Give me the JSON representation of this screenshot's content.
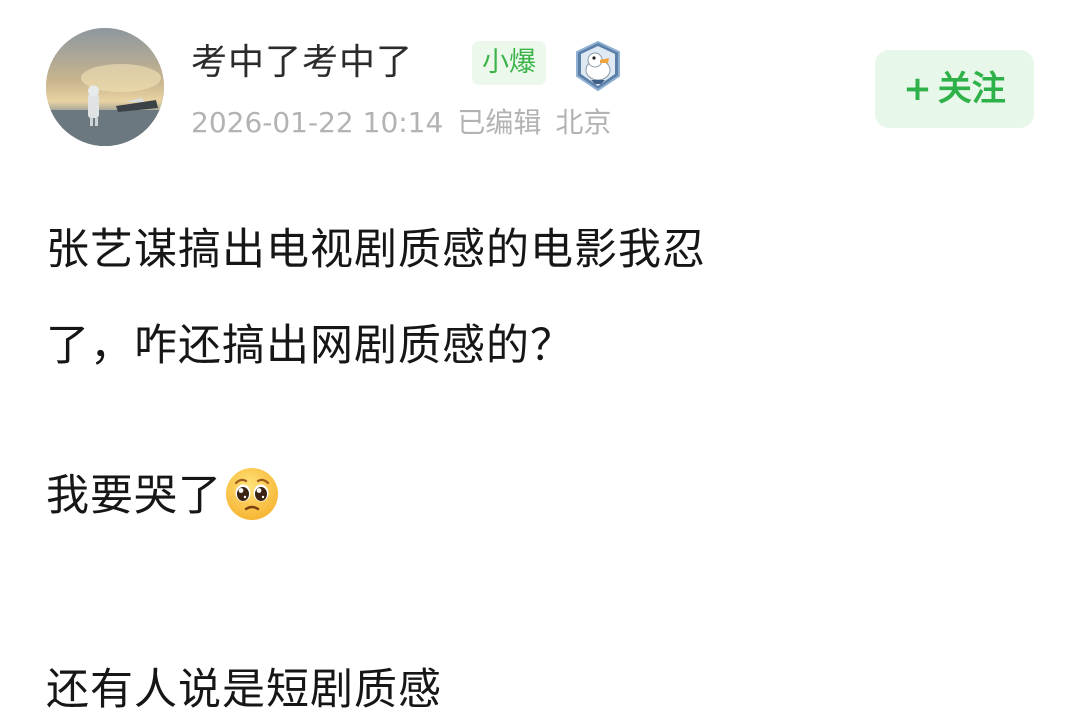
{
  "post": {
    "author": {
      "name": "考中了考中了",
      "tag": "小爆",
      "avatar_icon": "avatar-image",
      "badge_icon": "duck-badge-icon"
    },
    "meta": {
      "date": "2026-01-22 10:14",
      "edited": "已编辑",
      "location": "北京"
    },
    "follow": {
      "plus": "+",
      "label": "关注"
    },
    "text": {
      "line1": "张艺谋搞出电视剧质感的电影我忍",
      "line2": "了，咋还搞出网剧质感的？",
      "line3": "我要哭了",
      "line3_emoji": "pleading-face-icon",
      "line4": "还有人说是短剧质感"
    }
  },
  "colors": {
    "follow_bg": "#e7f7e9",
    "follow_text": "#2fb14a",
    "tag_bg": "#ecf8ec",
    "tag_text": "#3cb44a",
    "meta_text": "#b3b3b3"
  }
}
